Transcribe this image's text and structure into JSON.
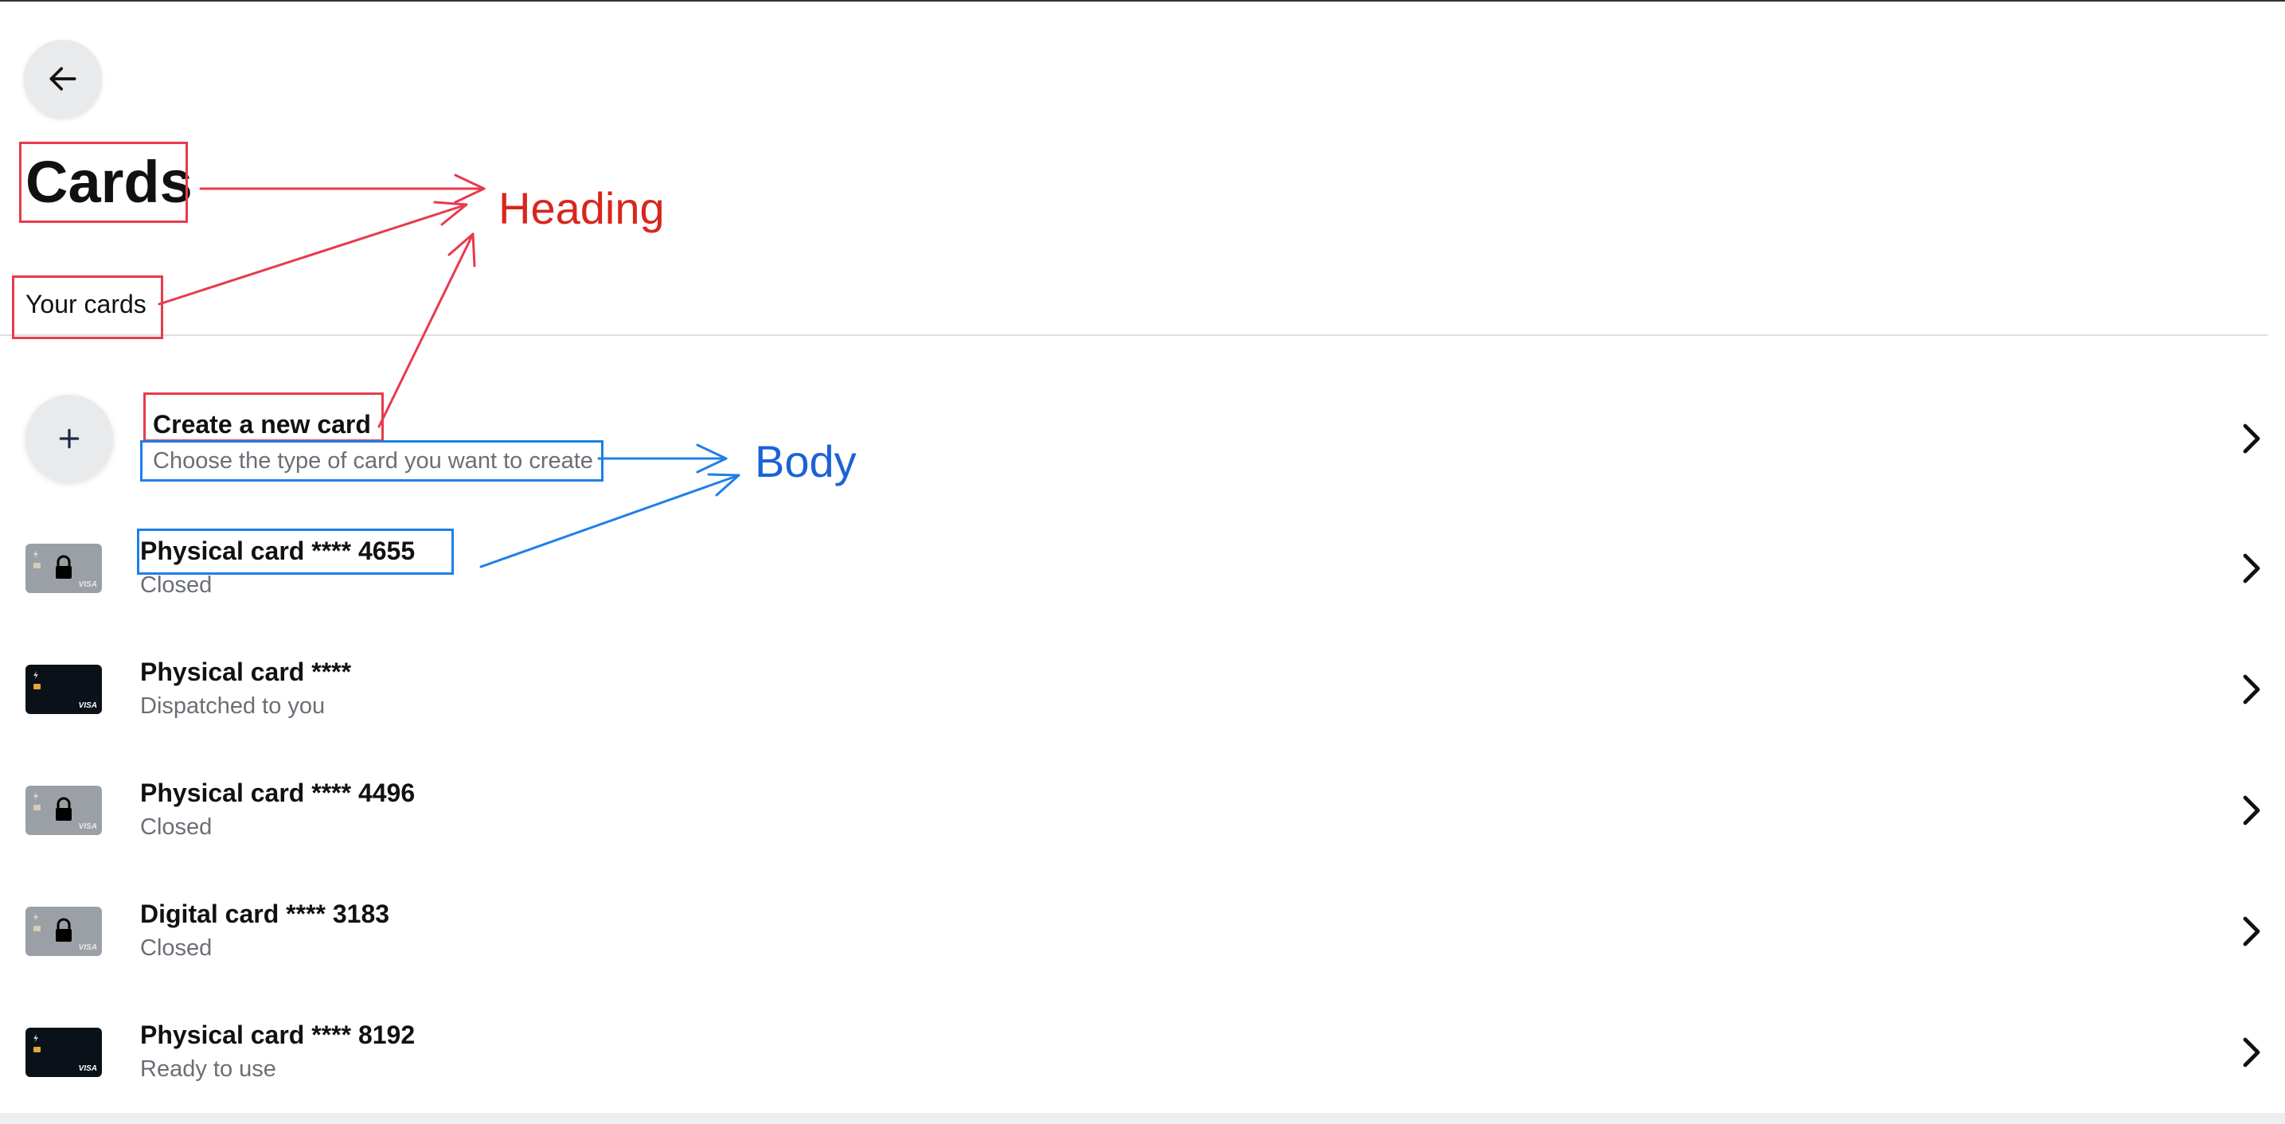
{
  "page": {
    "title": "Cards",
    "section_label": "Your cards"
  },
  "create_row": {
    "title": "Create a new card",
    "subtitle": "Choose the type of card you want to create"
  },
  "cards": [
    {
      "title": "Physical card **** 4655",
      "status": "Closed",
      "style": "gray-locked"
    },
    {
      "title": "Physical card ****",
      "status": "Dispatched to you",
      "style": "black"
    },
    {
      "title": "Physical card **** 4496",
      "status": "Closed",
      "style": "gray-locked"
    },
    {
      "title": "Digital card **** 3183",
      "status": "Closed",
      "style": "gray-locked"
    },
    {
      "title": "Physical card **** 8192",
      "status": "Ready to use",
      "style": "black"
    }
  ],
  "card_brand": "VISA",
  "annotations": {
    "heading_label": "Heading",
    "body_label": "Body",
    "heading_color": "#e83a4e",
    "body_color": "#1f7fe8"
  },
  "icons": {
    "back": "arrow-left-icon",
    "create": "plus-icon",
    "row_action": "chevron-right-icon",
    "locked": "lock-icon"
  }
}
